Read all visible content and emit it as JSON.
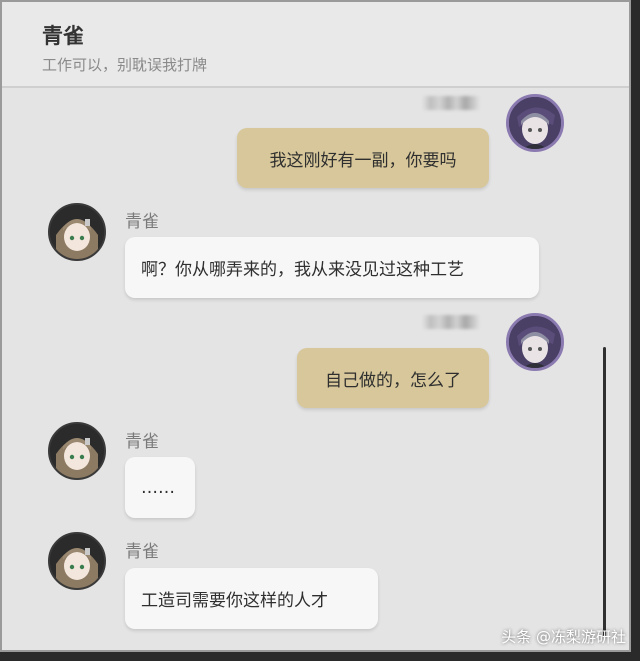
{
  "header": {
    "title": "青雀",
    "subtitle": "工作可以，别耽误我打牌"
  },
  "messages": [
    {
      "from": "player",
      "text": "我这刚好有一副，你要吗"
    },
    {
      "from": "npc",
      "name": "青雀",
      "text": "啊？你从哪弄来的，我从来没见过这种工艺"
    },
    {
      "from": "player",
      "text": "自己做的，怎么了"
    },
    {
      "from": "npc",
      "name": "青雀",
      "text": "……"
    },
    {
      "from": "npc",
      "name": "青雀",
      "text": "工造司需要你这样的人才"
    }
  ],
  "watermark": "头条 @冻梨游研社",
  "colors": {
    "panel": "#e4e4e4",
    "player_bubble": "#d7c79a",
    "npc_bubble": "#f7f7f7"
  },
  "icons": {
    "npc_avatar": "qingque-avatar-icon",
    "player_avatar": "trailblazer-avatar-icon"
  }
}
